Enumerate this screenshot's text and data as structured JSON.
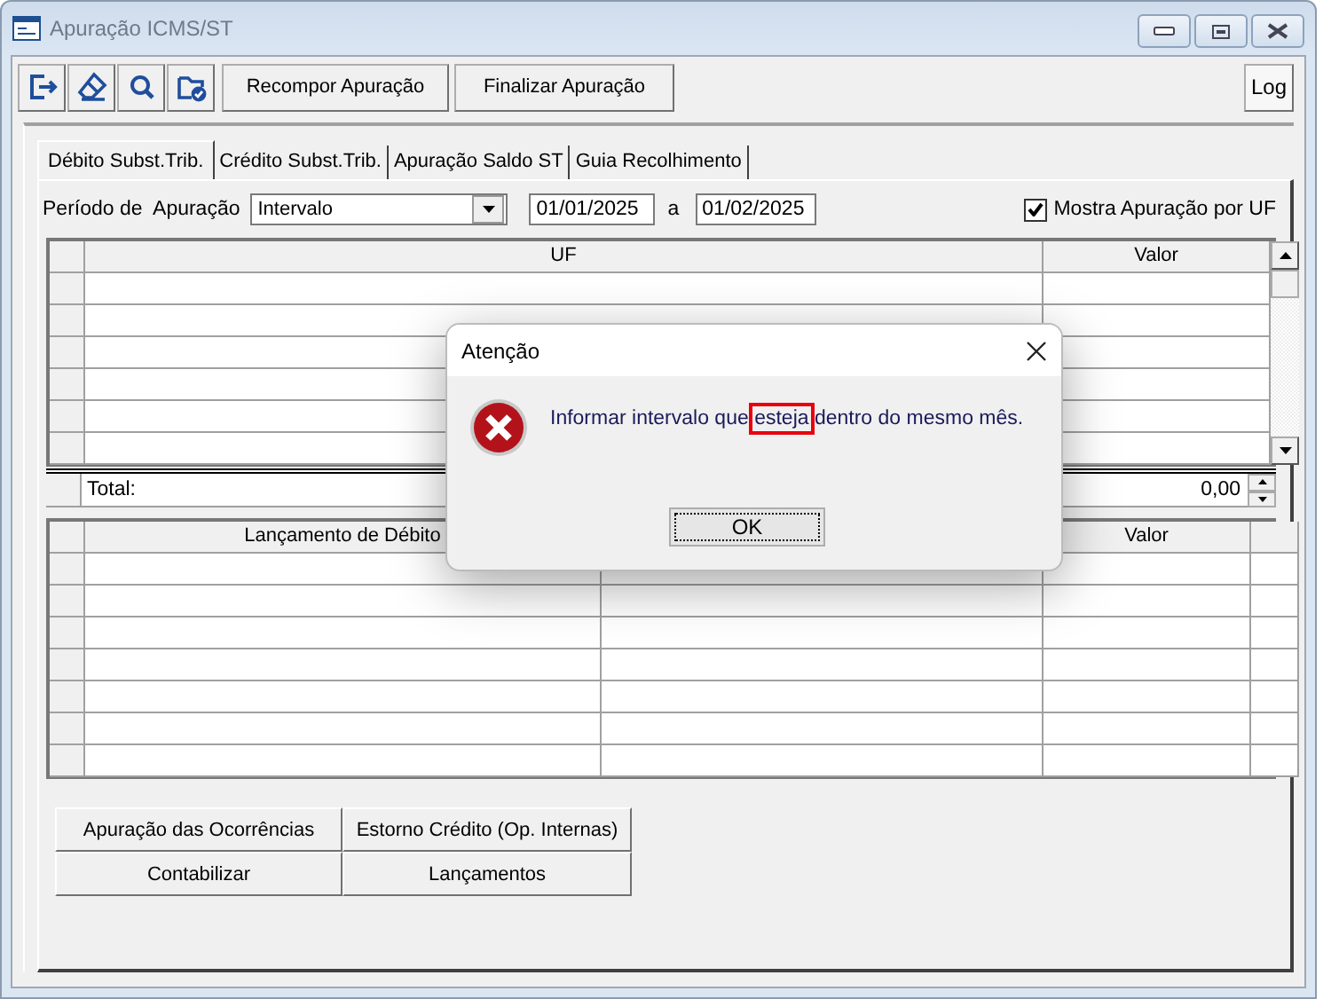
{
  "window": {
    "title": "Apuração ICMS/ST"
  },
  "toolbar": {
    "icon_buttons": [
      {
        "kind": "exit"
      },
      {
        "kind": "eraser"
      },
      {
        "kind": "search"
      },
      {
        "kind": "folder"
      }
    ],
    "buttons": [
      "Recompor Apuração",
      "Finalizar Apuração"
    ],
    "log_button": "Log"
  },
  "tabs": [
    {
      "label": "Débito Subst.Trib.",
      "selected": true
    },
    {
      "label": "Crédito Subst.Trib.",
      "selected": false
    },
    {
      "label": "Apuração Saldo ST",
      "selected": false
    },
    {
      "label": "Guia Recolhimento",
      "selected": false
    }
  ],
  "filter": {
    "label": "Período de  Apuração",
    "mode": "Intervalo",
    "date_from": "01/01/2025",
    "separator": "a",
    "date_to": "01/02/2025",
    "checkbox": {
      "label": "Mostra Apuração por UF",
      "checked": true
    }
  },
  "uf_table": {
    "columns": [
      "UF",
      "Valor"
    ]
  },
  "total": {
    "label": "Total:",
    "value": "0,00"
  },
  "debit_table": {
    "columns": [
      "Lançamento de Débito",
      "Valor"
    ]
  },
  "action_buttons": [
    "Apuração das Ocorrências",
    "Estorno Crédito (Op. Internas)",
    "Contabilizar",
    "Lançamentos"
  ],
  "dialog": {
    "title": "Atenção",
    "message_before": "Informar intervalo que",
    "message_highlight": "esteja",
    "message_after": "dentro do mesmo mês.",
    "button": "OK"
  }
}
